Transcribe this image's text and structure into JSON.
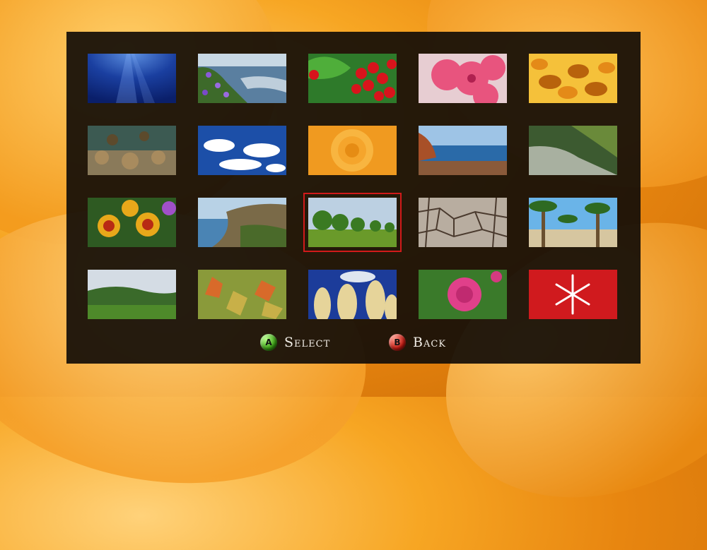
{
  "background": {
    "accent": "#f39a1c"
  },
  "gallery": {
    "selected_index": 12,
    "thumbnails": [
      {
        "name": "thumb-underwater-rays"
      },
      {
        "name": "thumb-coast-flowers"
      },
      {
        "name": "thumb-red-berries"
      },
      {
        "name": "thumb-pink-blossom"
      },
      {
        "name": "thumb-autumn-leaves"
      },
      {
        "name": "thumb-coral-reef"
      },
      {
        "name": "thumb-blue-sky-clouds"
      },
      {
        "name": "thumb-orange-rose"
      },
      {
        "name": "thumb-rocky-beach"
      },
      {
        "name": "thumb-mountain-stream"
      },
      {
        "name": "thumb-marigolds"
      },
      {
        "name": "thumb-sea-cliffs"
      },
      {
        "name": "thumb-park-trees"
      },
      {
        "name": "thumb-cracked-earth"
      },
      {
        "name": "thumb-palm-trees"
      },
      {
        "name": "thumb-green-hills"
      },
      {
        "name": "thumb-maple-leaves"
      },
      {
        "name": "thumb-pampas-grass"
      },
      {
        "name": "thumb-pink-rose"
      },
      {
        "name": "thumb-snowflake"
      }
    ]
  },
  "controls": {
    "select": {
      "button": "A",
      "label": "Select"
    },
    "back": {
      "button": "B",
      "label": "Back"
    }
  }
}
